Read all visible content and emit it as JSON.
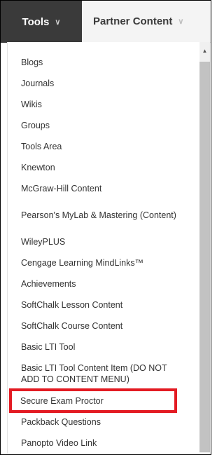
{
  "tabs": {
    "tools_label": "Tools",
    "partner_label": "Partner Content",
    "chevron": "∨"
  },
  "menu": {
    "items": [
      "Blogs",
      "Journals",
      "Wikis",
      "Groups",
      "Tools Area",
      "Knewton",
      "McGraw-Hill Content",
      "Pearson's MyLab & Mastering (Content)",
      "WileyPLUS",
      "Cengage Learning MindLinks™",
      "Achievements",
      "SoftChalk Lesson Content",
      "SoftChalk Course Content",
      "Basic LTI Tool",
      "Basic LTI Tool Content Item (DO NOT ADD TO CONTENT MENU)",
      "Secure Exam Proctor",
      "Packback Questions",
      "Panopto Video Link"
    ],
    "highlighted_item": "Secure Exam Proctor"
  },
  "colors": {
    "active_tab": "#3a3a3a",
    "highlight": "#e31b23"
  },
  "icons": {
    "scroll_up": "scroll-up-arrow-icon"
  }
}
